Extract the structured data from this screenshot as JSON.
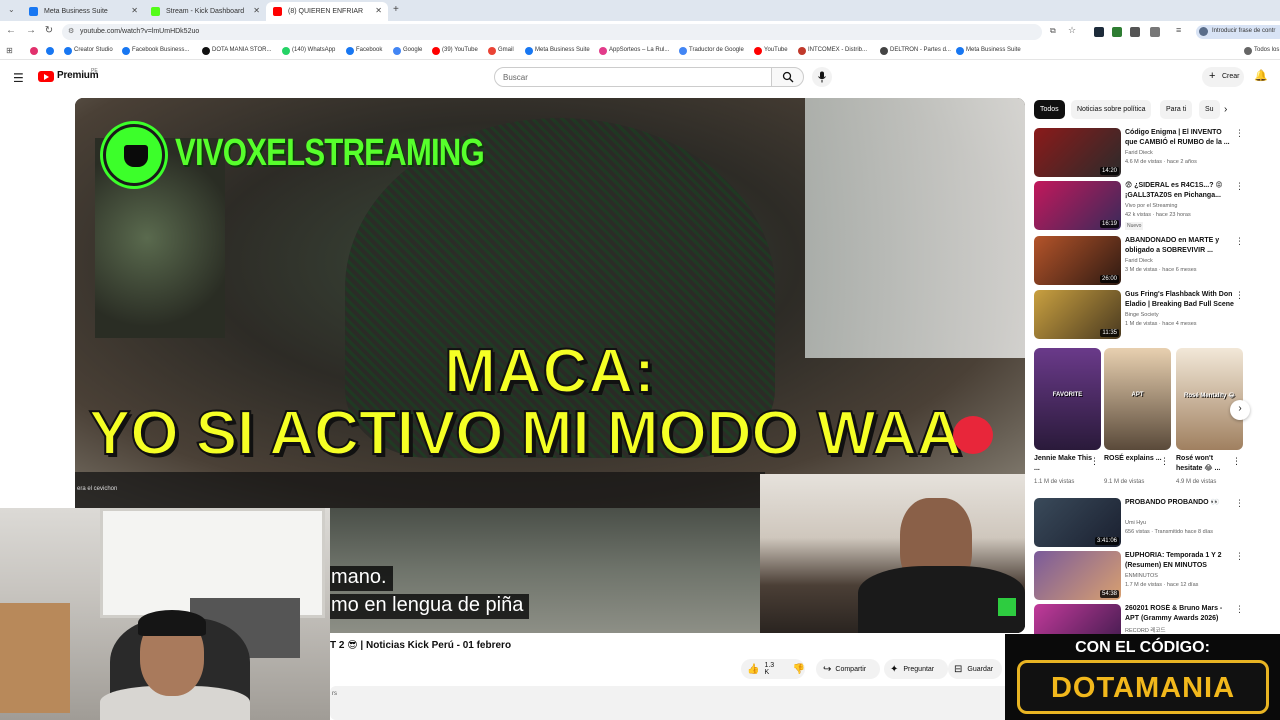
{
  "tabs": [
    {
      "label": "Meta Business Suite",
      "color": "#1877f2"
    },
    {
      "label": "Stream - Kick Dashboard",
      "color": "#53fc18"
    },
    {
      "label": "(8) QUIEREN ENFRIAR",
      "color": "#ff0000"
    }
  ],
  "browser": {
    "url": "youtube.com/watch?v=lmUmHDk52uo",
    "profile_label": "Introducir frase de contr"
  },
  "bookmarks": [
    {
      "label": "Creator Studio",
      "color": "#1877f2"
    },
    {
      "label": "Facebook Business...",
      "color": "#1877f2"
    },
    {
      "label": "DOTA MANIA STOR...",
      "color": "#111111"
    },
    {
      "label": "(140) WhatsApp",
      "color": "#25d366"
    },
    {
      "label": "Facebook",
      "color": "#1877f2"
    },
    {
      "label": "Google",
      "color": "#4285f4"
    },
    {
      "label": "(39) YouTube",
      "color": "#ff0000"
    },
    {
      "label": "Gmail",
      "color": "#ea4335"
    },
    {
      "label": "Meta Business Suite",
      "color": "#1877f2"
    },
    {
      "label": "AppSorteos – La Rul...",
      "color": "#e23b8a"
    },
    {
      "label": "Traductor de Google",
      "color": "#4285f4"
    },
    {
      "label": "YouTube",
      "color": "#ff0000"
    },
    {
      "label": "INTCOMEX - Distrib...",
      "color": "#c0392b"
    },
    {
      "label": "DELTRON - Partes d...",
      "color": "#444444"
    },
    {
      "label": "Meta Business Suite",
      "color": "#1877f2"
    },
    {
      "label": "Todos los",
      "color": "#666666"
    }
  ],
  "youtube": {
    "logo_text": "Premium",
    "country": "PE",
    "search_placeholder": "Buscar",
    "create_label": "Crear"
  },
  "video": {
    "channel_overlay": "VIVOXELSTREAMING",
    "caption_line1": "MACA:",
    "caption_line2": "YO SI ACTIVO MI MODO WAA",
    "credit_text": "era el cevichon",
    "subtitle_line1": "mano.",
    "subtitle_line2": "mo en lengua de piña",
    "title": "T 2 😎 | Noticias Kick Perú - 01 febrero",
    "likes": "1.3 K",
    "share_label": "Compartir",
    "ask_label": "Preguntar",
    "save_label": "Guardar",
    "desc_text": "rs"
  },
  "sidebar": {
    "chips": [
      "Todos",
      "Noticias sobre política",
      "Para ti",
      "Su"
    ],
    "videos": [
      {
        "title": "Código Enigma | El INVENTO que CAMBIÓ el RUMBO de la ...",
        "channel": "Farid Dieck",
        "meta": "4.6 M de vistas · hace 2 años",
        "duration": "14:20",
        "c1": "#8b1a1a",
        "c2": "#2b2b2b"
      },
      {
        "title": "😨 ¿SIDERAL es R4C1S...? 😡 ¡GALL3TAZ0S en Pichanga...",
        "channel": "Vivo por el Streaming",
        "meta": "42 k vistas · hace 23 horas",
        "duration": "16:19",
        "badge": "Nuevo",
        "c1": "#c2185b",
        "c2": "#3a2a5a"
      },
      {
        "title": "ABANDONADO en MARTE y obligado a SOBREVIVIR ...",
        "channel": "Farid Dieck",
        "meta": "3 M de vistas · hace 6 meses",
        "duration": "26:00",
        "c1": "#b5542a",
        "c2": "#2e1a12"
      },
      {
        "title": "Gus Fring's Flashback With Don Eladio | Breaking Bad Full Scene",
        "channel": "Binge Society",
        "meta": "1 M de vistas · hace 4 meses",
        "duration": "11:35",
        "c1": "#c9a040",
        "c2": "#4a3a20"
      },
      {
        "title": "PROBANDO PROBANDO 👀",
        "channel": "Umi Hyu",
        "meta": "656 vistas · Transmitido hace 8 días",
        "duration": "3:41:06",
        "c1": "#3a4a5a",
        "c2": "#1a2030"
      },
      {
        "title": "EUPHORIA: Temporada 1 Y 2 (Resumen) EN MINUTOS",
        "channel": "ENMINUTOS",
        "meta": "1.7 M de vistas · hace 12 días",
        "duration": "54:38",
        "c1": "#7a5a9a",
        "c2": "#d8a070"
      },
      {
        "title": "260201 ROSÉ & Bruno Mars - APT (Grammy Awards 2026)",
        "channel": "RECORD 레코드",
        "meta": "",
        "duration": "",
        "c1": "#c23a9a",
        "c2": "#3a1a4a"
      }
    ],
    "shorts": [
      {
        "title": "Jennie Make This ...",
        "meta": "1.1 M de vistas",
        "overlay": "FAVORITE",
        "c1": "#6a3a8a",
        "c2": "#2a1a3a"
      },
      {
        "title": "ROSÉ explains ...",
        "meta": "9.1 M de vistas",
        "overlay": "APT",
        "c1": "#e8d0b0",
        "c2": "#5a4a3a"
      },
      {
        "title": "Rosé won't hesitate 😂 ...",
        "meta": "4.9 M de vistas",
        "overlay": "Rosé Mentality 😂",
        "c1": "#f2e8d8",
        "c2": "#a08060"
      }
    ]
  },
  "promo": {
    "top": "CON EL CÓDIGO:",
    "code": "DOTAMANIA"
  }
}
